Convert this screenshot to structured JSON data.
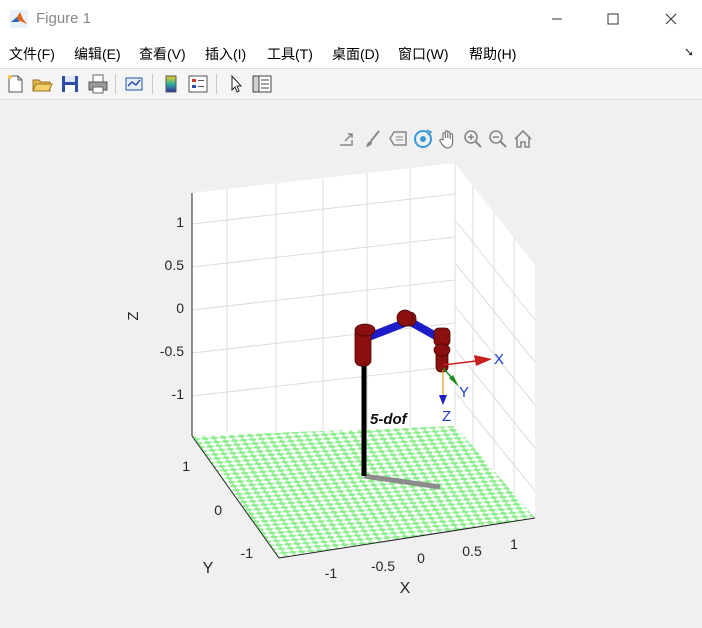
{
  "window": {
    "title": "Figure 1"
  },
  "menu": [
    "文件(F)",
    "编辑(E)",
    "查看(V)",
    "插入(I)",
    "工具(T)",
    "桌面(D)",
    "窗口(W)",
    "帮助(H)"
  ],
  "axes": {
    "z_label": "Z",
    "y_label": "Y",
    "x_label": "X",
    "z_ticks": [
      "1",
      "0.5",
      "0",
      "-0.5",
      "-1"
    ],
    "y_ticks": [
      "1",
      "0",
      "-1"
    ],
    "x_ticks": [
      "-1",
      "-0.5",
      "0",
      "0.5",
      "1"
    ]
  },
  "robot": {
    "name": "5-dof",
    "frame_labels": {
      "x": "X",
      "y": "Y",
      "z": "Z"
    }
  },
  "colors": {
    "link": "#1c1cc8",
    "joint": "#8b0f0f",
    "floor_a": "#8fee8f",
    "floor_b": "#ffffff",
    "frame_x": "#c81e1e",
    "frame_y": "#1e8c1e",
    "frame_z": "#1e1ec8",
    "frame_text": "#1e3cc8"
  }
}
